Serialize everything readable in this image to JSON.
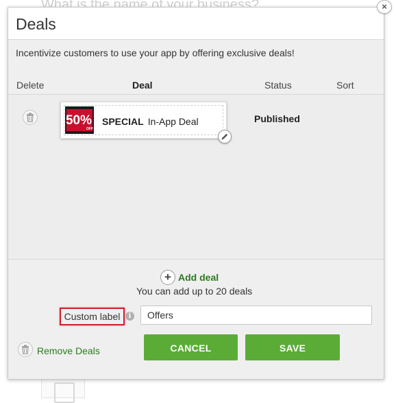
{
  "backdrop": {
    "faded_question": "What is the name of your business?"
  },
  "modal": {
    "title": "Deals",
    "intro": "Incentivize customers to use your app by offering exclusive deals!",
    "close_symbol": "×"
  },
  "columns": {
    "delete": "Delete",
    "deal": "Deal",
    "status": "Status",
    "sort": "Sort"
  },
  "deals": [
    {
      "badge_text": "50%",
      "badge_sub": "OFF",
      "name_bold": "SPECIAL",
      "name_rest": "In-App Deal",
      "status": "Published",
      "icons": {
        "delete": "trash-icon",
        "edit": "pencil-icon"
      }
    }
  ],
  "add_deal": {
    "label": "Add deal",
    "plus_symbol": "+",
    "limit_text": "You can add up to 20 deals"
  },
  "custom_label": {
    "label": "Custom label",
    "info_symbol": "i",
    "value": "Offers",
    "highlight_color": "#d0202a"
  },
  "footer": {
    "remove_label": "Remove Deals",
    "cancel_label": "CANCEL",
    "save_label": "SAVE"
  },
  "colors": {
    "accent_green": "#5aac36",
    "link_green": "#2b7a1f",
    "panel_background": "#efefef"
  }
}
